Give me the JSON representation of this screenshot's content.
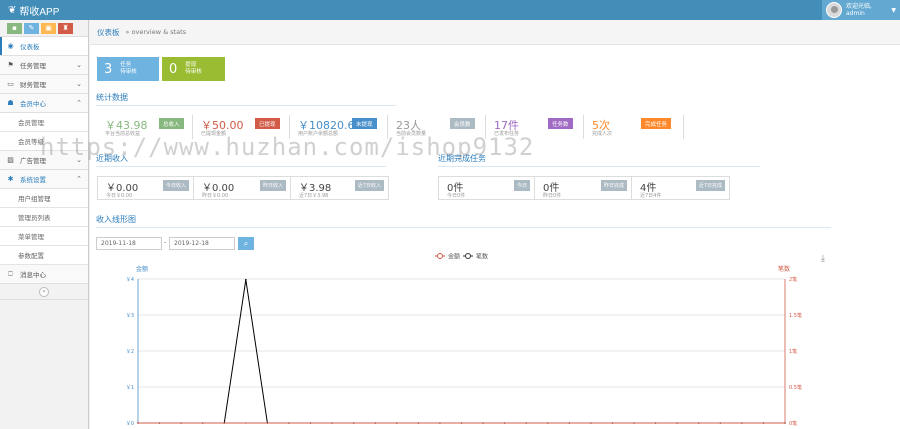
{
  "app": {
    "title": "帮收APP"
  },
  "user": {
    "greeting": "欢迎光临,",
    "name": "admin"
  },
  "sidebar": {
    "items": [
      {
        "label": "仪表板",
        "icon": "dashboard-icon",
        "glyph": "◉"
      },
      {
        "label": "任务管理",
        "icon": "flag-icon",
        "glyph": "⚑"
      },
      {
        "label": "财务管理",
        "icon": "money-icon",
        "glyph": "▭"
      },
      {
        "label": "会员中心",
        "icon": "users-icon",
        "glyph": "☗"
      },
      {
        "label": "广告管理",
        "icon": "picture-icon",
        "glyph": "▨"
      },
      {
        "label": "系统设置",
        "icon": "gear-icon",
        "glyph": "✱"
      },
      {
        "label": "消息中心",
        "icon": "bookmark-icon",
        "glyph": "⎕"
      }
    ],
    "sub_members": [
      "会员管理",
      "会员等级"
    ],
    "sub_system": [
      "用户组管理",
      "管理员列表",
      "菜单管理",
      "参数配置"
    ]
  },
  "breadcrumb": {
    "home": "仪表板",
    "sub": "» overview & stats"
  },
  "tiles": [
    {
      "num": "3",
      "l1": "任务",
      "l2": "待审核",
      "color": "#6fb3e0"
    },
    {
      "num": "0",
      "l1": "提现",
      "l2": "待审核",
      "color": "#9abc32"
    }
  ],
  "stats_title": "统计数据",
  "stats": [
    {
      "value": "￥43.98",
      "desc": "平台当前总收益",
      "badge": "总收入",
      "vcolor": "#87b87f",
      "bcolor": "#87b87f"
    },
    {
      "value": "￥50.00",
      "desc": "已提现金额",
      "badge": "已提现",
      "vcolor": "#d15b47",
      "bcolor": "#d15b47"
    },
    {
      "value": "￥10820.60",
      "desc": "用户账户余额总额",
      "badge": "未提现",
      "vcolor": "#478fca",
      "bcolor": "#478fca"
    },
    {
      "value": "23人",
      "desc": "当前会员数量",
      "badge": "会员数",
      "vcolor": "#999999",
      "bcolor": "#abbac3"
    },
    {
      "value": "17件",
      "desc": "已发布任务",
      "badge": "任务数",
      "vcolor": "#a069c3",
      "bcolor": "#a069c3"
    },
    {
      "value": "5次",
      "desc": "完成人次",
      "badge": "完成任务",
      "vcolor": "#ff892a",
      "bcolor": "#ff892a"
    }
  ],
  "income_title": "近期收入",
  "income": [
    {
      "value": "￥0.00",
      "desc": "今日￥0.00",
      "badge": "今日收入"
    },
    {
      "value": "￥0.00",
      "desc": "昨日￥0.00",
      "badge": "昨日收入"
    },
    {
      "value": "￥3.98",
      "desc": "近7日￥3.98",
      "badge": "近7日收入"
    }
  ],
  "tasks_title": "近期完成任务",
  "tasks": [
    {
      "value": "0件",
      "desc": "今日0件",
      "badge": "今日"
    },
    {
      "value": "0件",
      "desc": "昨日0件",
      "badge": "昨日完成"
    },
    {
      "value": "4件",
      "desc": "近7日4件",
      "badge": "近7日完成"
    }
  ],
  "chart_section_title": "收入线形图",
  "date_from": "2019-11-18",
  "date_to": "2019-12-18",
  "date_sep": "-",
  "search_icon": "search-icon",
  "download_icon": "download-icon",
  "watermark": "https://www.huzhan.com/ishop9132",
  "chart_data": {
    "type": "line",
    "title": "",
    "legend": [
      "金额",
      "笔数"
    ],
    "legend_position": "top-center",
    "y_left_label": "金额",
    "y_right_label": "笔数",
    "y_left_ticks": [
      "￥0",
      "￥1",
      "￥2",
      "￥3",
      "￥4"
    ],
    "y_right_ticks": [
      "0笔",
      "0.5笔",
      "1笔",
      "1.5笔",
      "2笔"
    ],
    "ylim": [
      0,
      4
    ],
    "y2lim": [
      0,
      2
    ],
    "grid": true,
    "x_count": 31,
    "series": [
      {
        "name": "金额",
        "color": "#000000",
        "values": [
          0,
          0,
          0,
          0,
          0,
          3.98,
          0,
          0,
          0,
          0,
          0,
          0,
          0,
          0,
          0,
          0,
          0,
          0,
          0,
          0,
          0,
          0,
          0,
          0,
          0,
          0,
          0,
          0,
          0,
          0,
          0
        ]
      },
      {
        "name": "笔数",
        "color": "#d15b47",
        "values": [
          0,
          0,
          0,
          0,
          0,
          0,
          0,
          0,
          0,
          0,
          0,
          0,
          0,
          0,
          0,
          0,
          0,
          0,
          0,
          0,
          0,
          0,
          0,
          0,
          0,
          0,
          0,
          0,
          0,
          0,
          0
        ]
      }
    ]
  }
}
